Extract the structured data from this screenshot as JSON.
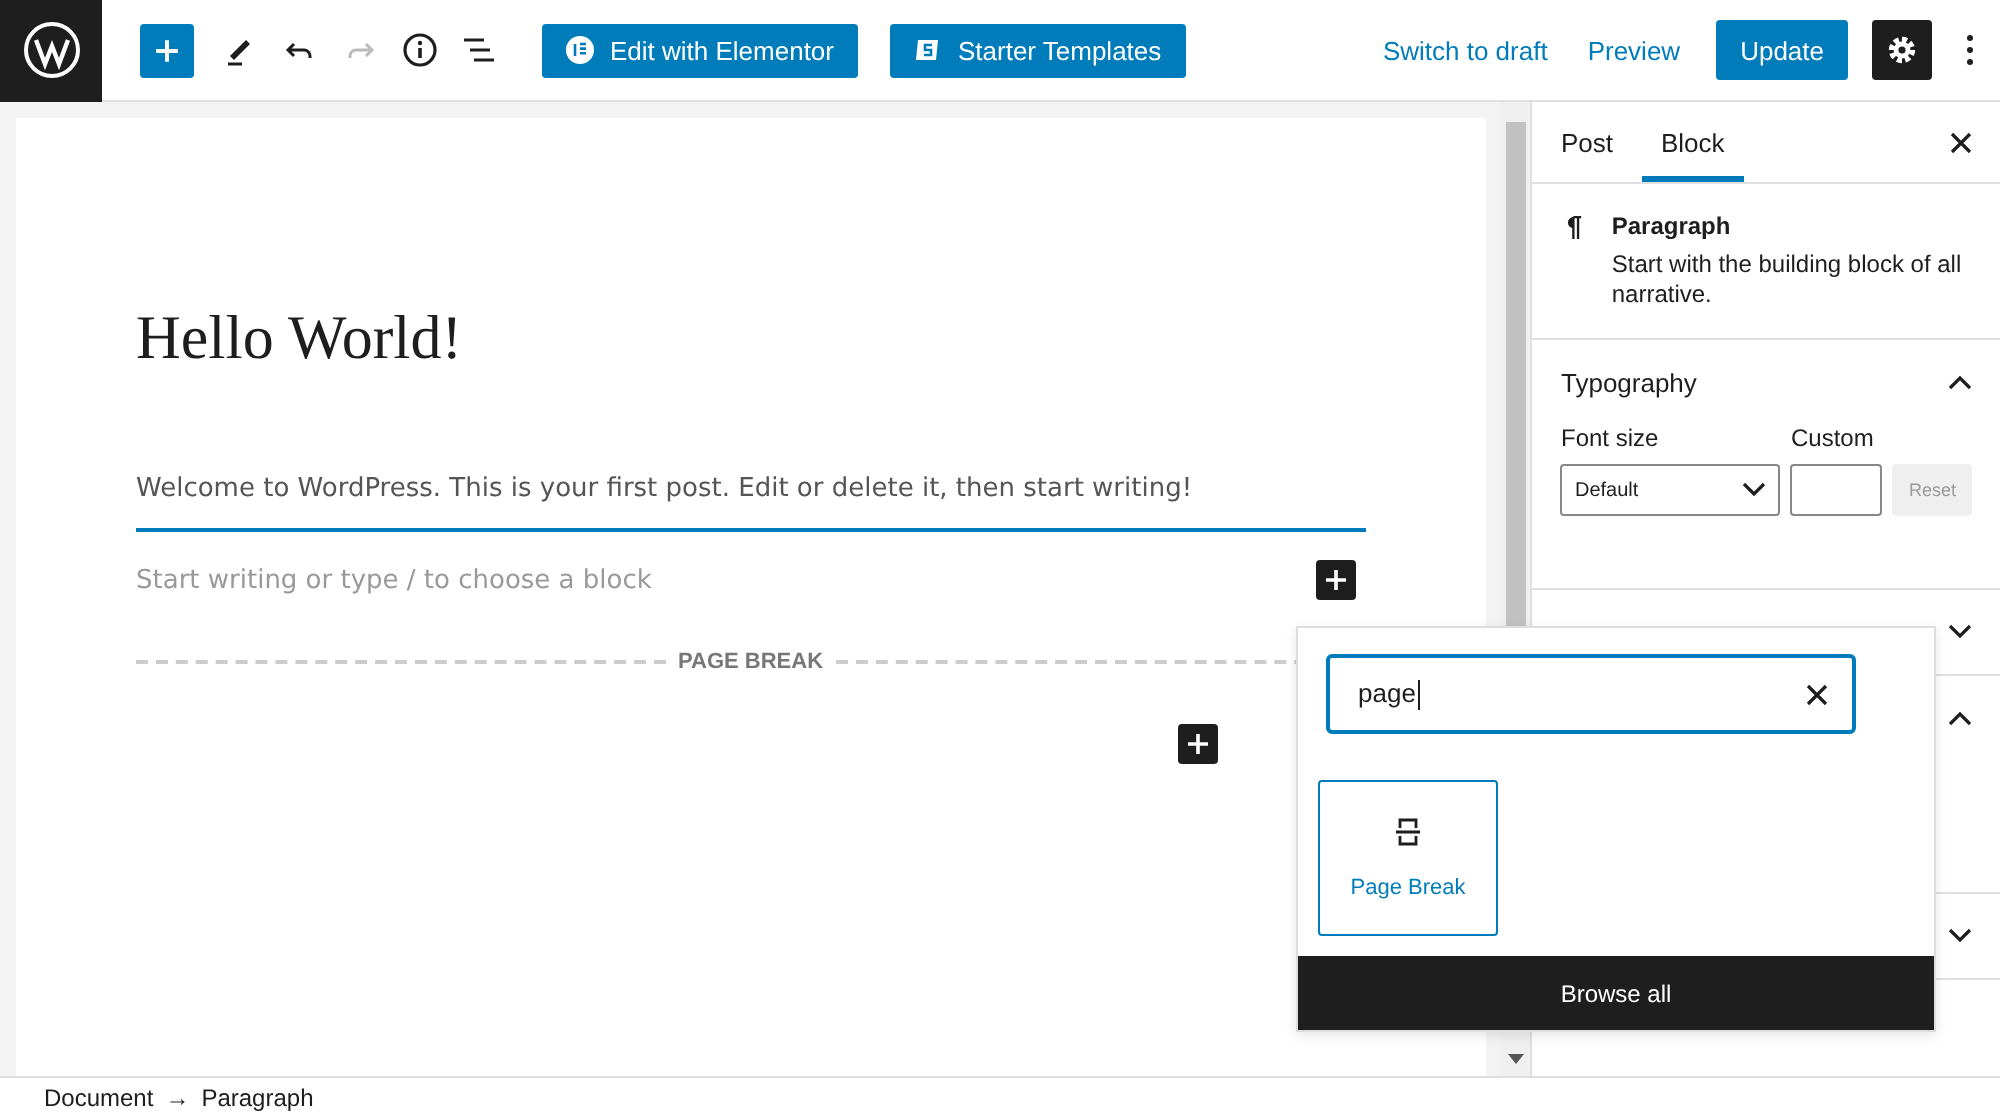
{
  "toolbar": {
    "inserter_open": true,
    "history": [
      {
        "kind": "undo",
        "disabled": false
      },
      {
        "kind": "redo",
        "disabled": true
      }
    ],
    "plugin_buttons": [
      {
        "kind": "elementor",
        "label": "Edit with Elementor"
      },
      {
        "kind": "templates",
        "label": "Starter Templates"
      }
    ],
    "links": [
      "Switch to draft",
      "Preview"
    ],
    "update": "Update",
    "settings_selected": true
  },
  "editor": {
    "title": "Hello World!",
    "paragraph": "Welcome to WordPress. This is your first post. Edit or delete it, then start writing!",
    "placeholder": "Start writing or type / to choose a block",
    "page_break": "PAGE BREAK"
  },
  "sidebar": {
    "tabs": [
      {
        "label": "Post",
        "selected": false
      },
      {
        "label": "Block",
        "selected": true
      }
    ],
    "block_card": {
      "title": "Paragraph",
      "description": "Start with the building block of all narrative."
    },
    "panels": [
      {
        "kind": "typography",
        "title": "Typography",
        "expanded": true
      },
      {
        "expanded": false
      },
      {
        "expanded": true
      },
      {
        "expanded": false
      }
    ],
    "typography": {
      "font_size_label": "Font size",
      "font_size_value": "Default",
      "custom_label": "Custom",
      "reset": "Reset",
      "reset_disabled": true
    }
  },
  "inserter": {
    "search_value": "page",
    "results": [
      {
        "label": "Page Break"
      }
    ],
    "browse_all": "Browse all"
  },
  "breadcrumb": [
    "Document",
    "→",
    "Paragraph"
  ]
}
